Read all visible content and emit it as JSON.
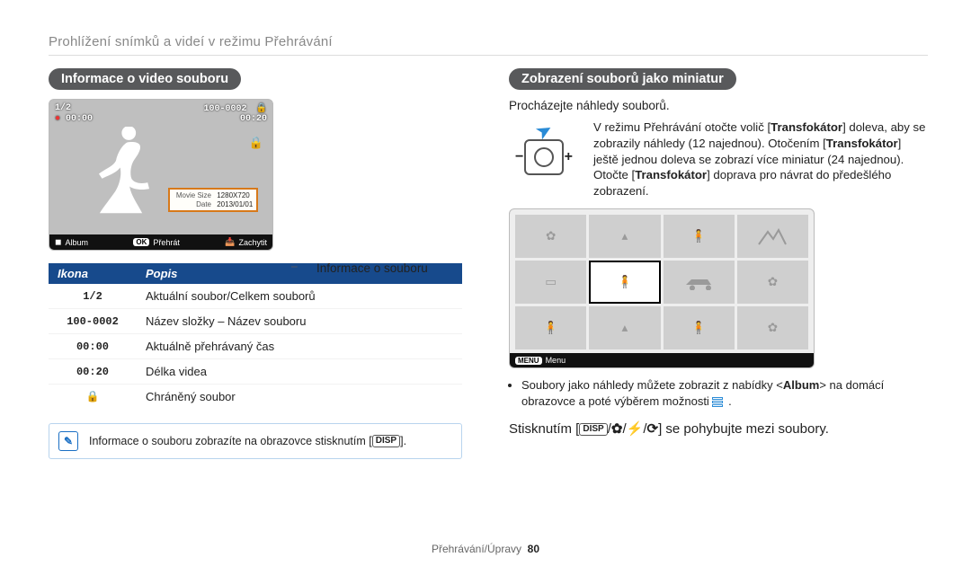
{
  "breadcrumb": "Prohlížení snímků a videí v režimu Přehrávání",
  "left": {
    "heading_pill": "Informace o video souboru",
    "lcd": {
      "counter": "1/2",
      "folder_file": "100-0002",
      "lock_icon": "🔒",
      "time_played": "00:00",
      "duration": "00:20",
      "rec_icon": "●",
      "infobox": {
        "row1_label": "Movie Size",
        "row1_value": "1280X720",
        "row2_label": "Date",
        "row2_value": "2013/01/01"
      },
      "bottom_left_icon": "◼",
      "bottom_left_text": "Album",
      "ok_glyph": "OK",
      "ok_text": "Přehrát",
      "capture_text": "Zachytit"
    },
    "info_callout": "Informace o souboru",
    "table": {
      "head_icon": "Ikona",
      "head_desc": "Popis",
      "rows": [
        {
          "icon": "1/2",
          "desc": "Aktuální soubor/Celkem souborů"
        },
        {
          "icon": "100-0002",
          "desc": "Název složky – Název souboru"
        },
        {
          "icon": "00:00",
          "desc": "Aktuálně přehrávaný čas"
        },
        {
          "icon": "00:20",
          "desc": "Délka videa"
        },
        {
          "icon": "🔒",
          "desc": "Chráněný soubor"
        }
      ]
    },
    "note": {
      "icon_label": "note-icon",
      "text_before": "Informace o souboru zobrazíte na obrazovce stisknutím [",
      "disp": "DISP",
      "text_after": "]."
    }
  },
  "right": {
    "heading_pill": "Zobrazení souborů jako miniatur",
    "intro": "Procházejte náhledy souborů.",
    "zoom": {
      "minus": "−",
      "plus": "+",
      "text_parts": {
        "a": "V režimu Přehrávání otočte volič [",
        "b": "Transfokátor",
        "c": "] doleva, aby se zobrazily náhledy (12 najednou). Otočením [",
        "d": "Transfokátor",
        "e": "] ještě jednou doleva se zobrazí více miniatur (24 najednou). Otočte [",
        "f": "Transfokátor",
        "g": "] doprava pro návrat do předešlého zobrazení."
      }
    },
    "thumb_lcd": {
      "menu_glyph": "MENU",
      "menu_text": "Menu",
      "glyphs": [
        "✿",
        "▴",
        "🧍",
        "▭",
        "🚗",
        "✿",
        "🧍",
        "▴",
        "◼",
        "◼",
        "◼",
        "◼"
      ]
    },
    "bullets": [
      {
        "a": "Soubory jako náhledy můžete zobrazit z nabídky <",
        "b": "Album",
        "c": "> na domácí obrazovce a poté výběrem možnosti ",
        "d": "."
      }
    ],
    "movecmd": {
      "a": "Stisknutím [",
      "disp": "DISP",
      "sep": "/",
      "g2": "✿",
      "g3": "⚡",
      "g4": "⟳",
      "b": "] se pohybujte mezi soubory."
    }
  },
  "footer": {
    "section": "Přehrávání/Úpravy",
    "page": "80"
  }
}
